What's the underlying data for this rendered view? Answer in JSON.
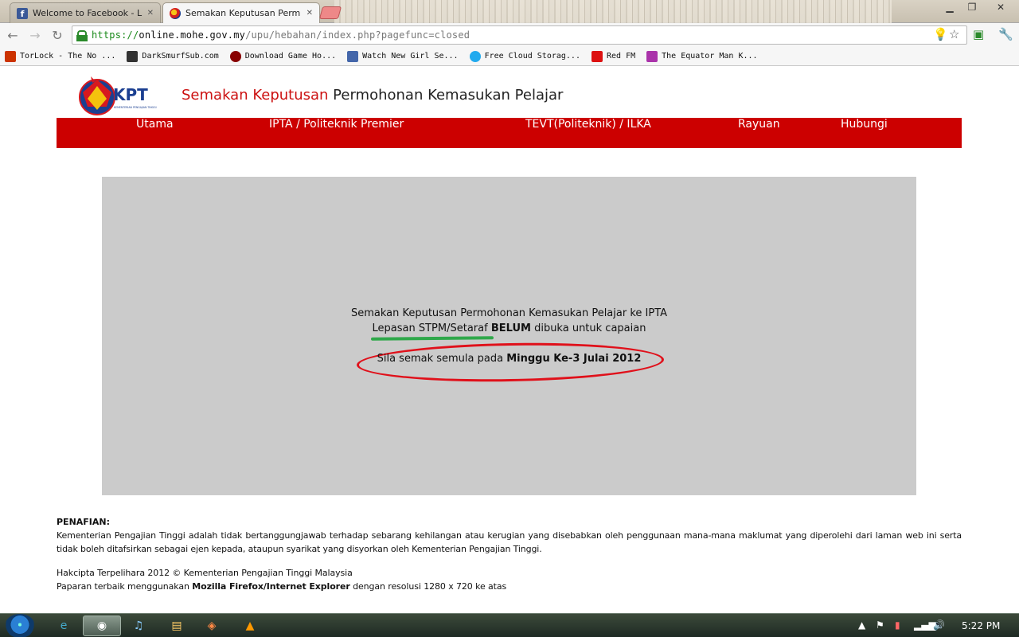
{
  "browser": {
    "tabs": [
      {
        "label": "Welcome to Facebook - L",
        "icon": "facebook-icon"
      },
      {
        "label": "Semakan Keputusan Perm",
        "icon": "kpt-favicon"
      }
    ],
    "url": {
      "scheme": "https://",
      "host": "online.mohe.gov.my",
      "path": "/upu/hebahan/index.php?pagefunc=closed"
    },
    "bookmarks": [
      {
        "label": "TorLock - The No ...",
        "color": "#cc3300"
      },
      {
        "label": "DarkSmurfSub.com",
        "color": "#333333"
      },
      {
        "label": "Download Game Ho...",
        "color": "#880000"
      },
      {
        "label": "Watch New Girl Se...",
        "color": "#4466aa"
      },
      {
        "label": "Free Cloud Storag...",
        "color": "#22aaee"
      },
      {
        "label": "Red FM",
        "color": "#dd1111"
      },
      {
        "label": "The Equator Man K...",
        "color": "#aa33aa"
      }
    ]
  },
  "site": {
    "title_red": "Semakan Keputusan",
    "title_rest": "Permohonan Kemasukan Pelajar",
    "logo_text": "KPT",
    "logo_subtext": "KEMENTERIAN PENGAJIAN TINGGI",
    "brand_color": "#cc0000"
  },
  "nav": {
    "items": [
      "Utama",
      "IPTA / Politeknik Premier",
      "TEVT(Politeknik) / ILKA",
      "Rayuan",
      "Hubungi"
    ]
  },
  "notice": {
    "line1": "Semakan Keputusan Permohonan Kemasukan Pelajar ke IPTA",
    "line2_underlined": "Lepasan STPM/Setaraf",
    "line2_bold": "BELUM",
    "line2_rest": "dibuka untuk capaian",
    "line3_prefix": "Sila semak semula pada",
    "line3_bold": "Minggu Ke-3 Julai 2012"
  },
  "footer": {
    "disclaimer_title": "PENAFIAN:",
    "disclaimer_body": "Kementerian Pengajian Tinggi adalah tidak bertanggungjawab terhadap sebarang kehilangan atau kerugian yang disebabkan oleh penggunaan mana-mana maklumat yang diperolehi dari laman web ini serta tidak boleh ditafsirkan sebagai ejen kepada, ataupun syarikat yang disyorkan oleh Kementerian Pengajian Tinggi.",
    "copyright": "Hakcipta Terpelihara 2012 © Kementerian Pengajian Tinggi Malaysia",
    "best_view_prefix": "Paparan terbaik menggunakan",
    "best_view_bold": "Mozilla Firefox/Internet Explorer",
    "best_view_suffix": "dengan resolusi 1280 x 720 ke atas"
  },
  "taskbar": {
    "clock": "5:22 PM"
  }
}
